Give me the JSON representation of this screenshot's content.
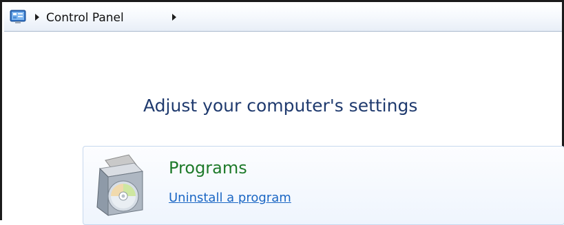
{
  "address_bar": {
    "icon": "control-panel-icon",
    "breadcrumb": [
      "Control Panel"
    ],
    "separator_icon": "chevron-right-icon"
  },
  "main": {
    "heading": "Adjust your computer's settings",
    "categories": [
      {
        "icon": "programs-box-icon",
        "title": "Programs",
        "task_links": [
          "Uninstall a program"
        ]
      }
    ]
  },
  "colors": {
    "heading": "#1f3a6e",
    "category_title": "#1e7a2a",
    "link": "#1a66c4",
    "panel_border": "#c7d8ee"
  }
}
